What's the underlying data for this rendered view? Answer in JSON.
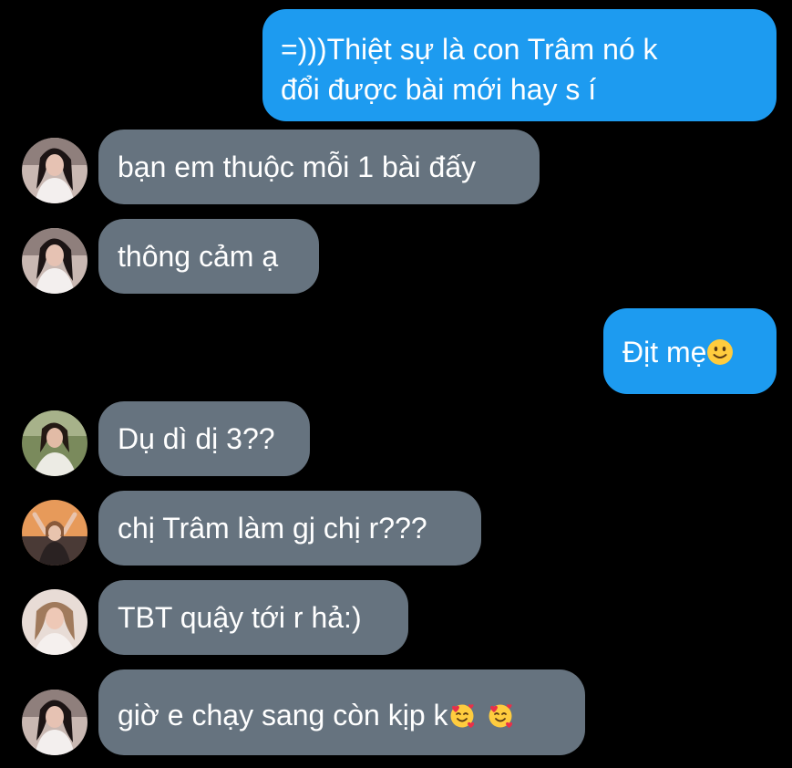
{
  "conversation": {
    "messages": [
      {
        "sender": "me",
        "text": "=)))Thiệt sự là con Trâm nó k",
        "text_line2": "đổi được bài mới hay s í"
      },
      {
        "sender": "other",
        "avatar_icon": "avatar-girl-white-top",
        "text": "bạn em thuộc mỗi 1 bài đấy"
      },
      {
        "sender": "other",
        "avatar_icon": "avatar-girl-white-top",
        "text": "thông cảm ạ"
      },
      {
        "sender": "me",
        "text": "Địt mẹ",
        "emoji": "slightly-smiling-face"
      },
      {
        "sender": "other",
        "avatar_icon": "avatar-girl-outdoor",
        "text": "Dụ dì dị 3??"
      },
      {
        "sender": "other",
        "avatar_icon": "avatar-girl-sunset",
        "text": "chị Trâm làm gj chị r???"
      },
      {
        "sender": "other",
        "avatar_icon": "avatar-girl-light-hair",
        "text": "TBT quậy tới r hả:)"
      },
      {
        "sender": "other",
        "avatar_icon": "avatar-girl-white-top",
        "text": "giờ e chạy sang còn kịp k",
        "emoji": "smiling-face-with-hearts"
      }
    ]
  },
  "colors": {
    "background": "#000000",
    "outgoing_bubble": "#1d9bf0",
    "incoming_bubble": "#66737f",
    "text": "#ffffff"
  }
}
